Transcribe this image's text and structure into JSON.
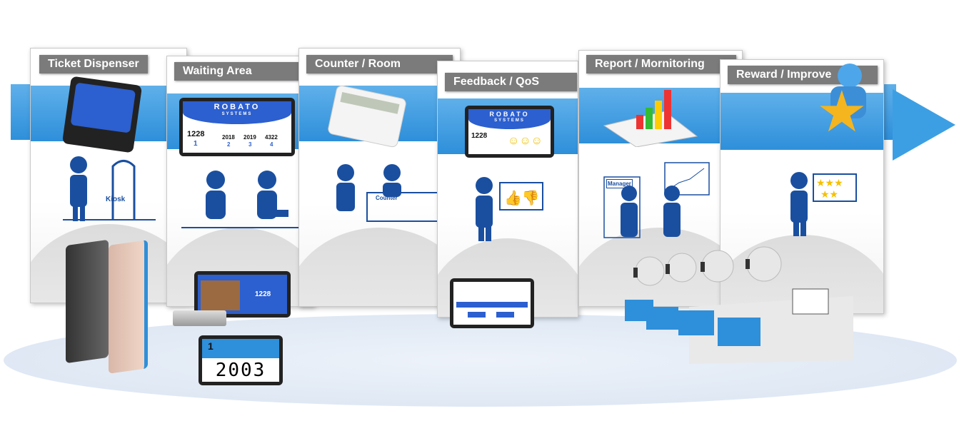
{
  "stages": [
    {
      "title": "Ticket Dispenser",
      "label": "Kiosk"
    },
    {
      "title": "Waiting Area"
    },
    {
      "title": "Counter / Room",
      "label": "Counter"
    },
    {
      "title": "Feedback / QoS"
    },
    {
      "title": "Report / Mornitoring",
      "label": "Manager"
    },
    {
      "title": "Reward / Improve"
    }
  ],
  "display": {
    "brand": "ROBATO",
    "brand_sub": "SYSTEMS",
    "main_ticket": "1228",
    "main_counter": "1",
    "tickets": [
      "2018",
      "2019",
      "4322"
    ],
    "counters": [
      "2",
      "3",
      "4"
    ]
  },
  "counter_display": {
    "counter": "1",
    "number": "2003"
  },
  "colors": {
    "accent": "#2e8fda",
    "title_bg": "#7b7b7b",
    "figure": "#1a4fa0"
  }
}
